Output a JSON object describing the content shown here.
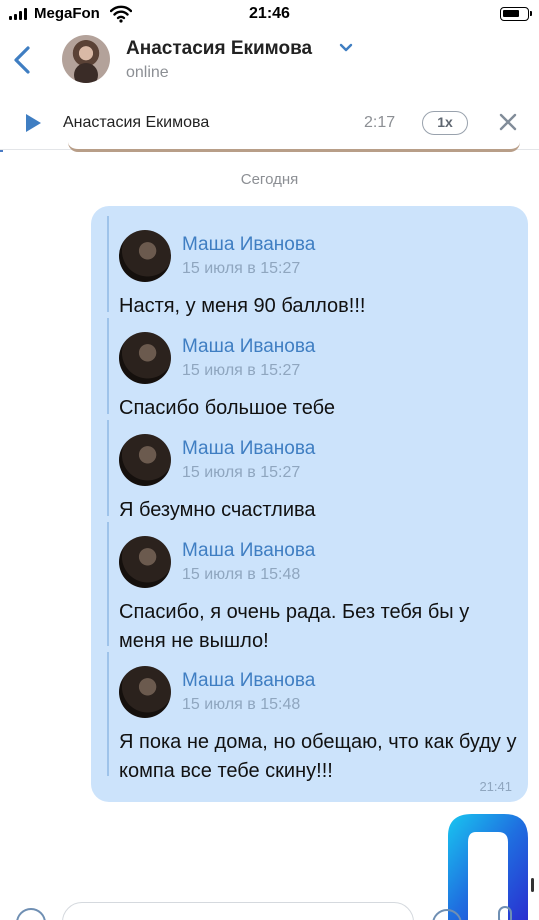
{
  "status_bar": {
    "carrier": "MegaFon",
    "time": "21:46"
  },
  "header": {
    "contact_name": "Анастасия Екимова",
    "contact_status": "online"
  },
  "player": {
    "track_title": "Анастасия Екимова",
    "time": "2:17",
    "speed": "1x"
  },
  "date_separator": "Сегодня",
  "message": {
    "time": "21:41",
    "forwarded": [
      {
        "author": "Маша Иванова",
        "date": "15 июля в 15:27",
        "text": "Настя, у меня 90 баллов!!!"
      },
      {
        "author": "Маша Иванова",
        "date": "15 июля в 15:27",
        "text": "Спасибо большое тебе"
      },
      {
        "author": "Маша Иванова",
        "date": "15 июля в 15:27",
        "text": "Я безумно счастлива"
      },
      {
        "author": "Маша Иванова",
        "date": "15 июля в 15:48",
        "text": "Спасибо, я очень рада. Без тебя бы у меня не вышло!"
      },
      {
        "author": "Маша Иванова",
        "date": "15 июля в 15:48",
        "text": "Я пока не дома, но обещаю, что как буду у компа все тебе скину!!!"
      }
    ]
  },
  "icons": {
    "back": "chevron-left-icon",
    "dropdown": "chevron-down-icon",
    "play": "play-icon",
    "close": "close-icon",
    "wifi": "wifi-icon",
    "battery": "battery-icon",
    "attach": "attach-icon",
    "emoji": "emoji-icon",
    "mic": "mic-icon"
  },
  "colors": {
    "accent": "#3f7ec2",
    "bubble": "#cce3fb",
    "secondary_text": "#8c8f94",
    "icon_blue": "#4a7bc4"
  }
}
